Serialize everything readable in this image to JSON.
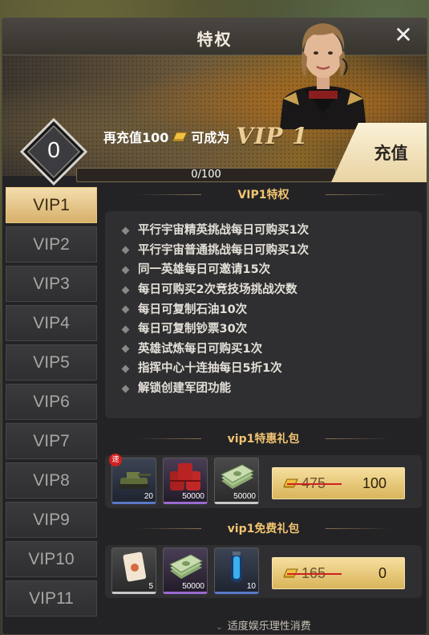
{
  "window": {
    "title": "特权",
    "close_icon": "close-icon"
  },
  "banner": {
    "level": "0",
    "recharge_prefix": "再充值100",
    "recharge_suffix": "可成为",
    "target_vip": "VIP 1",
    "progress_text": "0/100",
    "progress_fraction": 0,
    "charge_button": "充值"
  },
  "sidebar": {
    "tabs": [
      "VIP1",
      "VIP2",
      "VIP3",
      "VIP4",
      "VIP5",
      "VIP6",
      "VIP7",
      "VIP8",
      "VIP9",
      "VIP10",
      "VIP11"
    ],
    "active_index": 0
  },
  "privileges": {
    "title": "VIP1特权",
    "items": [
      "平行宇宙精英挑战每日可购买1次",
      "平行宇宙普通挑战每日可购买1次",
      "同一英雄每日可邀请15次",
      "每日可购买2次竞技场挑战次数",
      "每日可复制石油10次",
      "每日可复制钞票30次",
      "英雄试炼每日可购买1次",
      "指挥中心十连抽每日5折1次",
      "解锁创建军团功能"
    ]
  },
  "discount_pack": {
    "title": "vip1特惠礼包",
    "badge": "速",
    "items": [
      {
        "icon": "tank-icon",
        "count": "20",
        "rarity": "blue"
      },
      {
        "icon": "oil-barrels-icon",
        "count": "50000",
        "rarity": "purple"
      },
      {
        "icon": "cash-stack-icon",
        "count": "50000",
        "rarity": "white"
      }
    ],
    "old_price": "475",
    "price": "100"
  },
  "free_pack": {
    "title": "vip1免费礼包",
    "items": [
      {
        "icon": "card-envelope-icon",
        "count": "5",
        "rarity": "white"
      },
      {
        "icon": "cash-stack-icon",
        "count": "50000",
        "rarity": "purple"
      },
      {
        "icon": "energy-capsule-icon",
        "count": "10",
        "rarity": "blue"
      }
    ],
    "old_price": "165",
    "price": "0"
  },
  "footer": {
    "note": "适度娱乐理性消费"
  },
  "colors": {
    "accent_gold": "#f2c570",
    "active_tab": "#d7b06a",
    "panel": "#232326"
  }
}
